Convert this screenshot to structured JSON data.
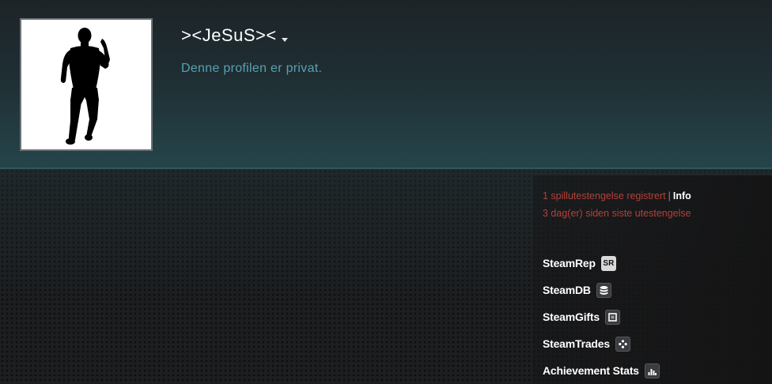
{
  "profile": {
    "persona_name": ">&lt;JeSuS>&lt;",
    "privacy_status": "Denne profilen er privat."
  },
  "bans": {
    "game_ban_text": "1 spillutestengelse registrert",
    "separator": "|",
    "info_link": "Info",
    "last_ban_text": "3 dag(er) siden siste utestengelse"
  },
  "external_links": [
    {
      "label": "SteamRep",
      "icon": "steamrep-icon",
      "badge_text": "SR"
    },
    {
      "label": "SteamDB",
      "icon": "steamdb-icon"
    },
    {
      "label": "SteamGifts",
      "icon": "steamgifts-icon"
    },
    {
      "label": "SteamTrades",
      "icon": "steamtrades-icon"
    },
    {
      "label": "Achievement Stats",
      "icon": "achievement-stats-icon"
    }
  ],
  "colors": {
    "privacy_text": "#56a2b1",
    "ban_text": "#b5403a",
    "header_gradient_end": "#25454b"
  }
}
